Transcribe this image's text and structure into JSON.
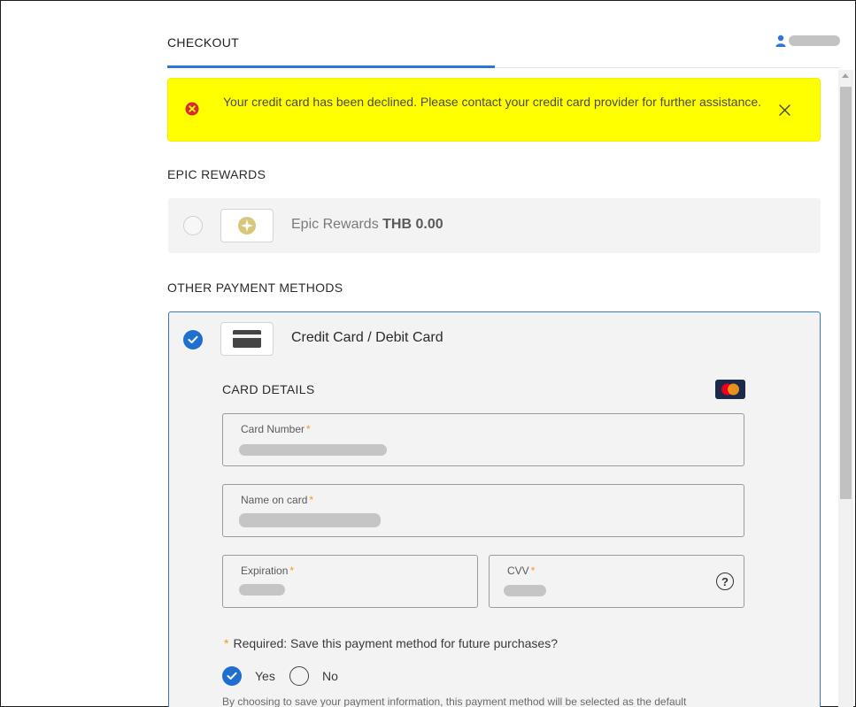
{
  "header": {
    "title": "CHECKOUT"
  },
  "error_banner": {
    "message": "Your credit card has been declined. Please contact your credit card provider for further assistance."
  },
  "rewards_section": {
    "title": "EPIC REWARDS",
    "label": "Epic Rewards",
    "amount": "THB 0.00"
  },
  "other_methods": {
    "title": "OTHER PAYMENT METHODS",
    "credit_card": {
      "label": "Credit Card / Debit Card",
      "details_title": "CARD DETAILS",
      "fields": {
        "card_number": "Card Number",
        "name_on_card": "Name on card",
        "expiration": "Expiration",
        "cvv": "CVV"
      },
      "required_mark": "*",
      "help_glyph": "?",
      "save_question": "Required: Save this payment method for future purchases?",
      "options": {
        "yes": "Yes",
        "no": "No"
      },
      "selected_option": "yes",
      "footer_note": "By choosing to save your payment information, this payment method will be selected as the default"
    }
  },
  "colors": {
    "accent": "#2a78d6",
    "error_banner_bg": "#ffff00",
    "error_icon": "#d32f2f",
    "required": "#f39c12"
  }
}
